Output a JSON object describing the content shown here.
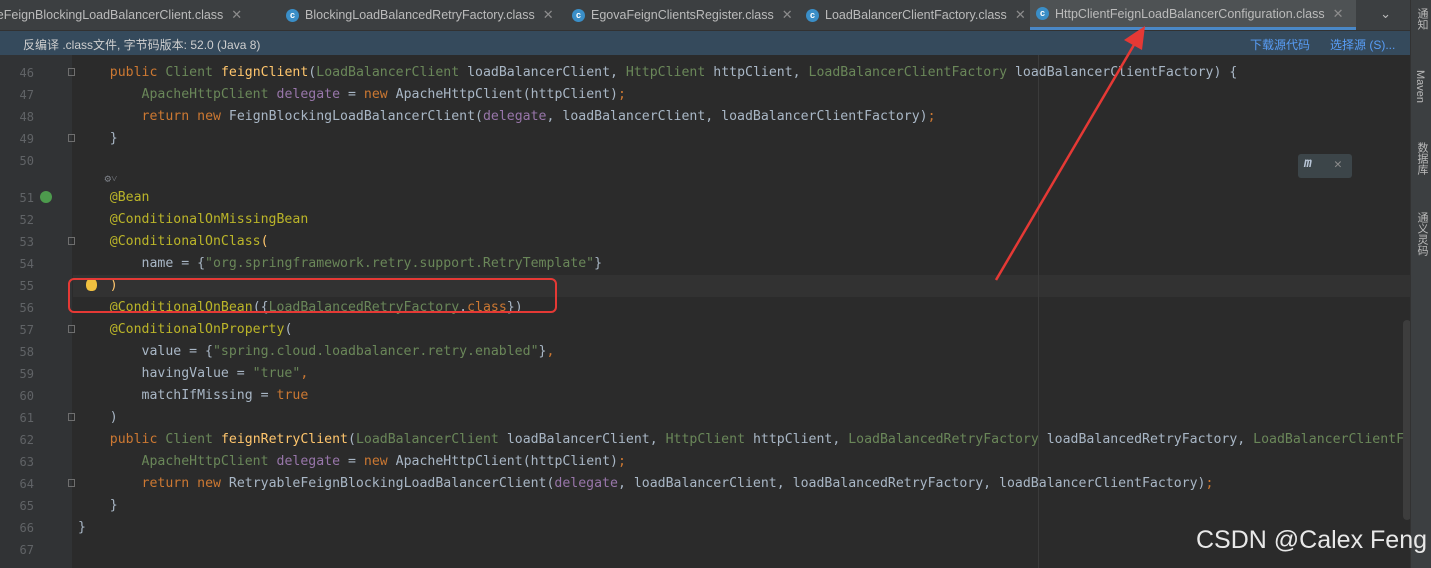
{
  "tabs": [
    {
      "label": "leFeignBlockingLoadBalancerClient.class",
      "active": false
    },
    {
      "label": "BlockingLoadBalancedRetryFactory.class",
      "active": false
    },
    {
      "label": "EgovaFeignClientsRegister.class",
      "active": false
    },
    {
      "label": "LoadBalancerClientFactory.class",
      "active": false
    },
    {
      "label": "HttpClientFeignLoadBalancerConfiguration.class",
      "active": true
    }
  ],
  "infobar": {
    "message": "反编译 .class文件, 字节码版本: 52.0 (Java 8)",
    "download_link": "下载源代码",
    "choose_link": "选择源 (S)..."
  },
  "right_strip": {
    "notifications": "通知",
    "maven": "Maven",
    "database": "数据库",
    "tongyi": "通义灵码"
  },
  "watermark": "CSDN @Calex Feng",
  "lines": [
    {
      "num": "46",
      "tokens": [
        [
          "    ",
          ""
        ],
        [
          "public",
          "kw"
        ],
        [
          " ",
          ""
        ],
        [
          "Client",
          "cls"
        ],
        [
          " ",
          ""
        ],
        [
          "feignClient",
          "fn"
        ],
        [
          "(",
          ""
        ],
        [
          "LoadBalancerClient",
          "cls"
        ],
        [
          " loadBalancerClient, ",
          ""
        ],
        [
          "HttpClient",
          "cls"
        ],
        [
          " httpClient, ",
          ""
        ],
        [
          "LoadBalancerClientFactory",
          "cls"
        ],
        [
          " loadBalancerClientFactory) {",
          ""
        ]
      ]
    },
    {
      "num": "47",
      "tokens": [
        [
          "        ",
          ""
        ],
        [
          "ApacheHttpClient",
          "cls"
        ],
        [
          " ",
          ""
        ],
        [
          "delegate",
          "param"
        ],
        [
          " = ",
          ""
        ],
        [
          "new",
          "kw"
        ],
        [
          " ApacheHttpClient(httpClient)",
          ""
        ],
        [
          ";",
          "kw"
        ]
      ]
    },
    {
      "num": "48",
      "tokens": [
        [
          "        ",
          ""
        ],
        [
          "return",
          "kw"
        ],
        [
          " ",
          ""
        ],
        [
          "new",
          "kw"
        ],
        [
          " FeignBlockingLoadBalancerClient(",
          ""
        ],
        [
          "delegate",
          "param"
        ],
        [
          ", loadBalancerClient, loadBalancerClientFactory)",
          ""
        ],
        [
          ";",
          "kw"
        ]
      ]
    },
    {
      "num": "49",
      "tokens": [
        [
          "    }",
          ""
        ]
      ]
    },
    {
      "num": "50",
      "tokens": []
    },
    {
      "num": "",
      "tokens": [
        [
          "    ⚙˅",
          "hint"
        ]
      ]
    },
    {
      "num": "51",
      "tokens": [
        [
          "    ",
          ""
        ],
        [
          "@Bean",
          "ann"
        ]
      ]
    },
    {
      "num": "52",
      "tokens": [
        [
          "    ",
          ""
        ],
        [
          "@ConditionalOnMissingBean",
          "ann"
        ]
      ]
    },
    {
      "num": "53",
      "tokens": [
        [
          "    ",
          ""
        ],
        [
          "@ConditionalOnClass",
          "ann"
        ],
        [
          "(",
          "fn"
        ]
      ]
    },
    {
      "num": "54",
      "tokens": [
        [
          "        name = {",
          ""
        ],
        [
          "\"org.springframework.retry.support.RetryTemplate\"",
          "str"
        ],
        [
          "}",
          ""
        ]
      ]
    },
    {
      "num": "55",
      "tokens": [
        [
          "    ",
          ""
        ],
        [
          ")",
          "fn"
        ]
      ]
    },
    {
      "num": "56",
      "tokens": [
        [
          "    ",
          ""
        ],
        [
          "@ConditionalOnBean",
          "ann"
        ],
        [
          "({",
          ""
        ],
        [
          "LoadBalancedRetryFactory",
          "cls"
        ],
        [
          ".",
          ""
        ],
        [
          "class",
          "kw"
        ],
        [
          "})",
          ""
        ]
      ]
    },
    {
      "num": "57",
      "tokens": [
        [
          "    ",
          ""
        ],
        [
          "@ConditionalOnProperty",
          "ann"
        ],
        [
          "(",
          ""
        ]
      ]
    },
    {
      "num": "58",
      "tokens": [
        [
          "        value = {",
          ""
        ],
        [
          "\"spring.cloud.loadbalancer.retry.enabled\"",
          "str"
        ],
        [
          "}",
          ""
        ],
        [
          ",",
          "kw"
        ]
      ]
    },
    {
      "num": "59",
      "tokens": [
        [
          "        havingValue = ",
          ""
        ],
        [
          "\"true\"",
          "str"
        ],
        [
          ",",
          "kw"
        ]
      ]
    },
    {
      "num": "60",
      "tokens": [
        [
          "        matchIfMissing = ",
          ""
        ],
        [
          "true",
          "kw"
        ]
      ]
    },
    {
      "num": "61",
      "tokens": [
        [
          "    )",
          ""
        ]
      ]
    },
    {
      "num": "62",
      "tokens": [
        [
          "    ",
          ""
        ],
        [
          "public",
          "kw"
        ],
        [
          " ",
          ""
        ],
        [
          "Client",
          "cls"
        ],
        [
          " ",
          ""
        ],
        [
          "feignRetryClient",
          "fn"
        ],
        [
          "(",
          ""
        ],
        [
          "LoadBalancerClient",
          "cls"
        ],
        [
          " loadBalancerClient, ",
          ""
        ],
        [
          "HttpClient",
          "cls"
        ],
        [
          " httpClient, ",
          ""
        ],
        [
          "LoadBalancedRetryFactory",
          "cls"
        ],
        [
          " loadBalancedRetryFactory, ",
          ""
        ],
        [
          "LoadBalancerClientF",
          "cls"
        ]
      ]
    },
    {
      "num": "63",
      "tokens": [
        [
          "        ",
          ""
        ],
        [
          "ApacheHttpClient",
          "cls"
        ],
        [
          " ",
          ""
        ],
        [
          "delegate",
          "param"
        ],
        [
          " = ",
          ""
        ],
        [
          "new",
          "kw"
        ],
        [
          " ApacheHttpClient(httpClient)",
          ""
        ],
        [
          ";",
          "kw"
        ]
      ]
    },
    {
      "num": "64",
      "tokens": [
        [
          "        ",
          ""
        ],
        [
          "return",
          "kw"
        ],
        [
          " ",
          ""
        ],
        [
          "new",
          "kw"
        ],
        [
          " RetryableFeignBlockingLoadBalancerClient(",
          ""
        ],
        [
          "delegate",
          "param"
        ],
        [
          ", loadBalancerClient, loadBalancedRetryFactory, loadBalancerClientFactory)",
          ""
        ],
        [
          ";",
          "kw"
        ]
      ]
    },
    {
      "num": "65",
      "tokens": [
        [
          "    }",
          ""
        ]
      ]
    },
    {
      "num": "66",
      "tokens": [
        [
          "}",
          ""
        ]
      ]
    },
    {
      "num": "67",
      "tokens": []
    }
  ],
  "colors": {
    "accent": "#4a88c7",
    "annotation_box": "#e53935",
    "arrow": "#e53935"
  }
}
